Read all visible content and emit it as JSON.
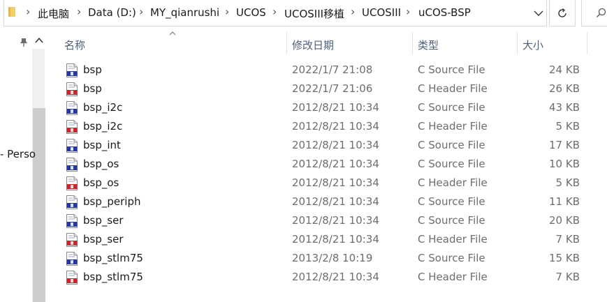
{
  "address_bar": {
    "breadcrumbs": [
      "此电脑",
      "Data (D:)",
      "MY_qianrushi",
      "UCOS",
      "UCOSIII移植",
      "UCOSIII",
      "uCOS-BSP"
    ]
  },
  "nav_pane": {
    "partial_item": "- Perso"
  },
  "columns": {
    "name": "名称",
    "modified": "修改日期",
    "type": "类型",
    "size": "大小"
  },
  "files": [
    {
      "name": "bsp",
      "modified": "2022/1/7 21:08",
      "type": "C Source File",
      "size": "24 KB",
      "icon": "c-source-file-icon"
    },
    {
      "name": "bsp",
      "modified": "2022/1/7 21:06",
      "type": "C Header File",
      "size": "26 KB",
      "icon": "c-header-file-icon"
    },
    {
      "name": "bsp_i2c",
      "modified": "2012/8/21 10:34",
      "type": "C Source File",
      "size": "43 KB",
      "icon": "c-source-file-icon"
    },
    {
      "name": "bsp_i2c",
      "modified": "2012/8/21 10:34",
      "type": "C Header File",
      "size": "5 KB",
      "icon": "c-header-file-icon"
    },
    {
      "name": "bsp_int",
      "modified": "2012/8/21 10:34",
      "type": "C Source File",
      "size": "17 KB",
      "icon": "c-source-file-icon"
    },
    {
      "name": "bsp_os",
      "modified": "2012/8/21 10:34",
      "type": "C Source File",
      "size": "10 KB",
      "icon": "c-source-file-icon"
    },
    {
      "name": "bsp_os",
      "modified": "2012/8/21 10:34",
      "type": "C Header File",
      "size": "5 KB",
      "icon": "c-header-file-icon"
    },
    {
      "name": "bsp_periph",
      "modified": "2012/8/21 10:34",
      "type": "C Source File",
      "size": "11 KB",
      "icon": "c-source-file-icon"
    },
    {
      "name": "bsp_ser",
      "modified": "2012/8/21 10:34",
      "type": "C Source File",
      "size": "20 KB",
      "icon": "c-source-file-icon"
    },
    {
      "name": "bsp_ser",
      "modified": "2012/8/21 10:34",
      "type": "C Header File",
      "size": "7 KB",
      "icon": "c-header-file-icon"
    },
    {
      "name": "bsp_stlm75",
      "modified": "2013/2/8 10:19",
      "type": "C Source File",
      "size": "15 KB",
      "icon": "c-source-file-icon"
    },
    {
      "name": "bsp_stlm75",
      "modified": "2012/8/21 10:34",
      "type": "C Header File",
      "size": "7 KB",
      "icon": "c-header-file-icon"
    }
  ],
  "colors": {
    "source_icon_band": "#2236a8",
    "header_icon_band": "#c8262c",
    "header_text": "#4c607a",
    "meta_text": "#6d6d6d"
  }
}
